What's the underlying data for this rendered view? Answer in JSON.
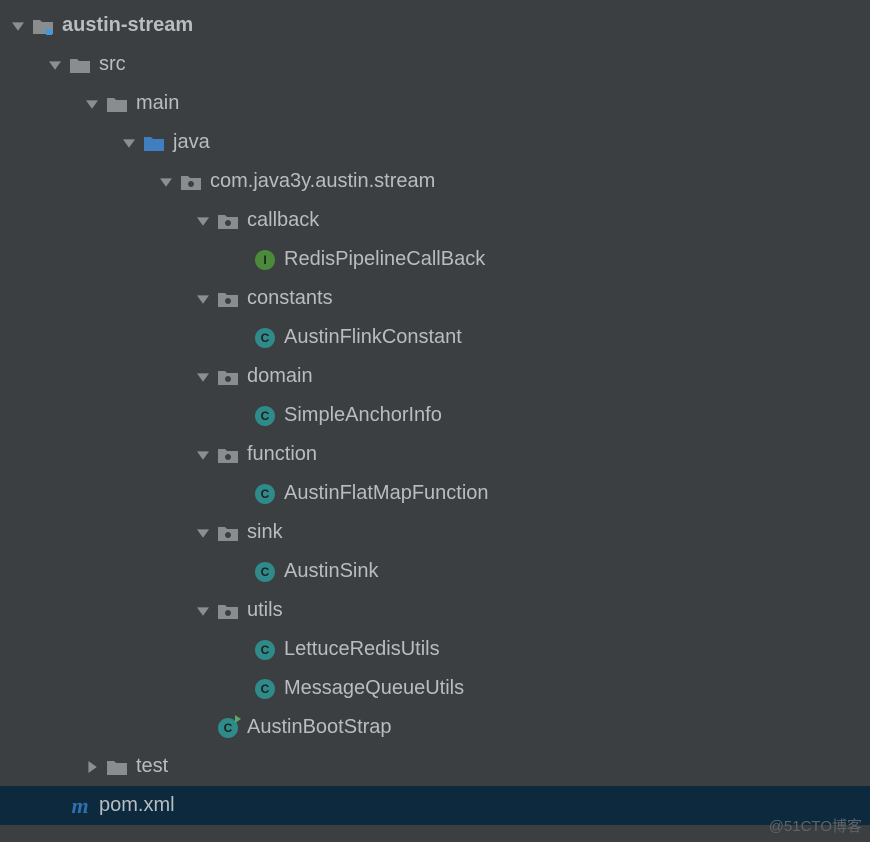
{
  "watermark": "@51CTO博客",
  "indentUnit": 37,
  "baseIndent": 10,
  "icons": {
    "module": "module",
    "folder": "folder",
    "folderSource": "folder-source",
    "package": "package",
    "class": "class",
    "interface": "interface",
    "classRunnable": "class-runnable",
    "maven": "maven"
  },
  "tree": [
    {
      "depth": 0,
      "arrow": "down",
      "icon": "module",
      "label": "austin-stream",
      "bold": true
    },
    {
      "depth": 1,
      "arrow": "down",
      "icon": "folder",
      "label": "src"
    },
    {
      "depth": 2,
      "arrow": "down",
      "icon": "folder",
      "label": "main"
    },
    {
      "depth": 3,
      "arrow": "down",
      "icon": "folderSource",
      "label": "java"
    },
    {
      "depth": 4,
      "arrow": "down",
      "icon": "package",
      "label": "com.java3y.austin.stream"
    },
    {
      "depth": 5,
      "arrow": "down",
      "icon": "package",
      "label": "callback"
    },
    {
      "depth": 6,
      "arrow": "none",
      "icon": "interface",
      "label": "RedisPipelineCallBack"
    },
    {
      "depth": 5,
      "arrow": "down",
      "icon": "package",
      "label": "constants"
    },
    {
      "depth": 6,
      "arrow": "none",
      "icon": "class",
      "label": "AustinFlinkConstant"
    },
    {
      "depth": 5,
      "arrow": "down",
      "icon": "package",
      "label": "domain"
    },
    {
      "depth": 6,
      "arrow": "none",
      "icon": "class",
      "label": "SimpleAnchorInfo"
    },
    {
      "depth": 5,
      "arrow": "down",
      "icon": "package",
      "label": "function"
    },
    {
      "depth": 6,
      "arrow": "none",
      "icon": "class",
      "label": "AustinFlatMapFunction"
    },
    {
      "depth": 5,
      "arrow": "down",
      "icon": "package",
      "label": "sink"
    },
    {
      "depth": 6,
      "arrow": "none",
      "icon": "class",
      "label": "AustinSink"
    },
    {
      "depth": 5,
      "arrow": "down",
      "icon": "package",
      "label": "utils"
    },
    {
      "depth": 6,
      "arrow": "none",
      "icon": "class",
      "label": "LettuceRedisUtils"
    },
    {
      "depth": 6,
      "arrow": "none",
      "icon": "class",
      "label": "MessageQueueUtils"
    },
    {
      "depth": 5,
      "arrow": "none",
      "icon": "classRunnable",
      "label": "AustinBootStrap"
    },
    {
      "depth": 2,
      "arrow": "right",
      "icon": "folder",
      "label": "test"
    },
    {
      "depth": 1,
      "arrow": "none",
      "icon": "maven",
      "label": "pom.xml",
      "selected": true
    }
  ]
}
